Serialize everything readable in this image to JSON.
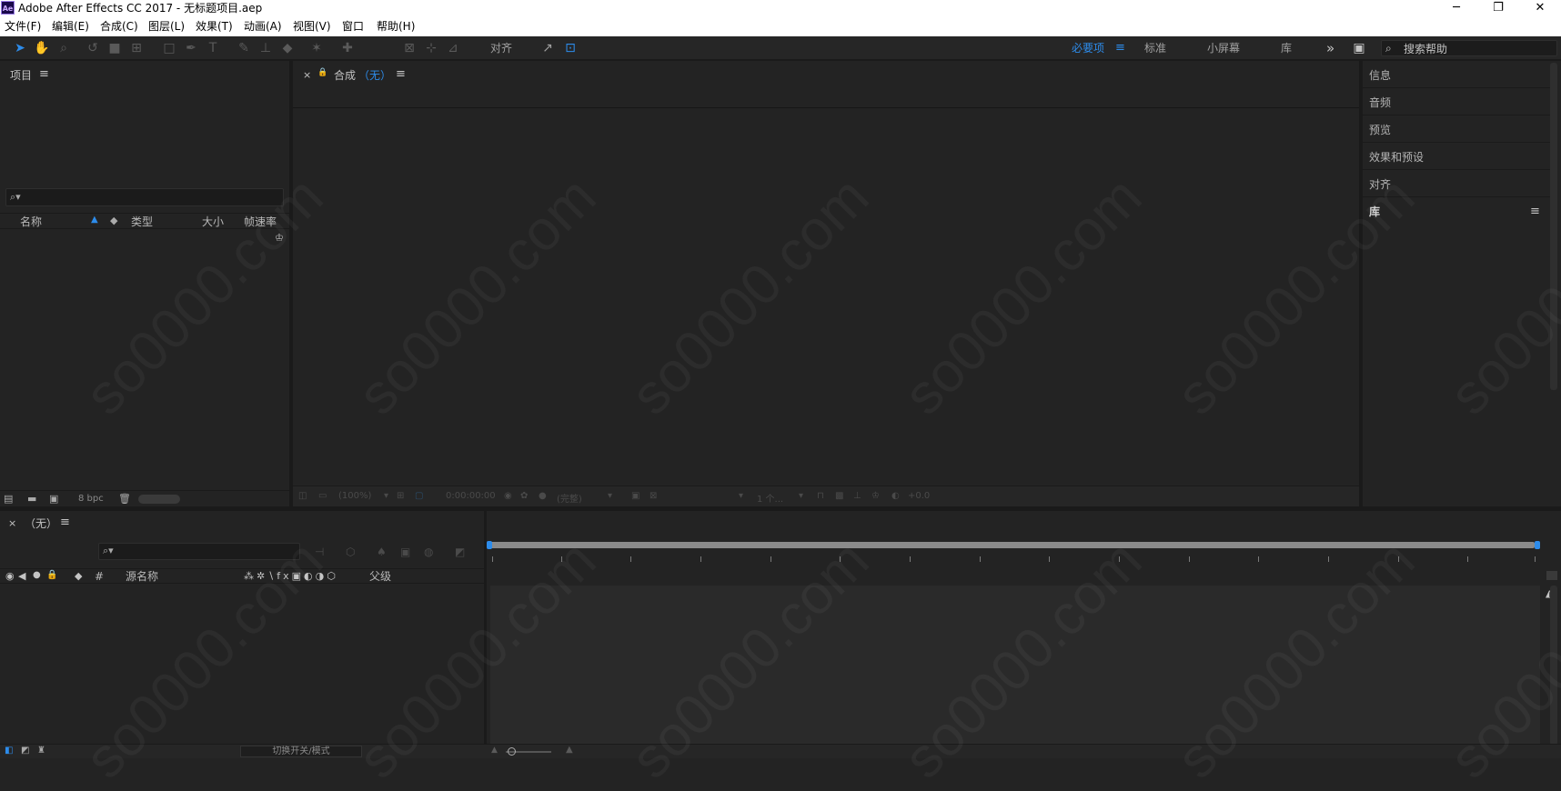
{
  "app": {
    "logo": "Ae",
    "title": "Adobe After Effects CC 2017 - 无标题项目.aep"
  },
  "window_controls": {
    "minimize": "─",
    "restore": "❐",
    "close": "✕"
  },
  "menu": [
    "文件(F)",
    "编辑(E)",
    "合成(C)",
    "图层(L)",
    "效果(T)",
    "动画(A)",
    "视图(V)",
    "窗口",
    "帮助(H)"
  ],
  "toolbar": {
    "align_label": "对齐",
    "workspaces": [
      "必要项",
      "标准",
      "小屏幕",
      "库"
    ],
    "more": "»",
    "search_help_placeholder": "搜索帮助",
    "menu_icon": "≡"
  },
  "project": {
    "title": "项目",
    "menu_icon": "≡",
    "search_glyph": "⌕▾",
    "columns": [
      "名称",
      "类型",
      "大小",
      "帧速率"
    ],
    "bpc": "8 bpc"
  },
  "composition": {
    "close": "×",
    "lock": "🔒",
    "label": "合成",
    "name": "（无）",
    "menu_icon": "≡",
    "footer": {
      "zoom": "(100%)",
      "time": "0:00:00:00",
      "quality": "(完整)",
      "view": "1 个...",
      "exposure": "+0.0"
    }
  },
  "right_panel": {
    "items": [
      "信息",
      "音频",
      "预览",
      "效果和预设",
      "对齐"
    ],
    "library": "库",
    "menu_icon": "≡"
  },
  "timeline": {
    "close": "×",
    "title": "（无）",
    "menu_icon": "≡",
    "search_glyph": "⌕▾",
    "col_source": "源名称",
    "col_parent": "父级",
    "col_hash": "#",
    "switch_modes": "切换开关/模式"
  },
  "watermark": "so0000.com",
  "colors": {
    "accent": "#2d8ceb",
    "bg": "#232323",
    "titlebar": "#ffffff"
  }
}
